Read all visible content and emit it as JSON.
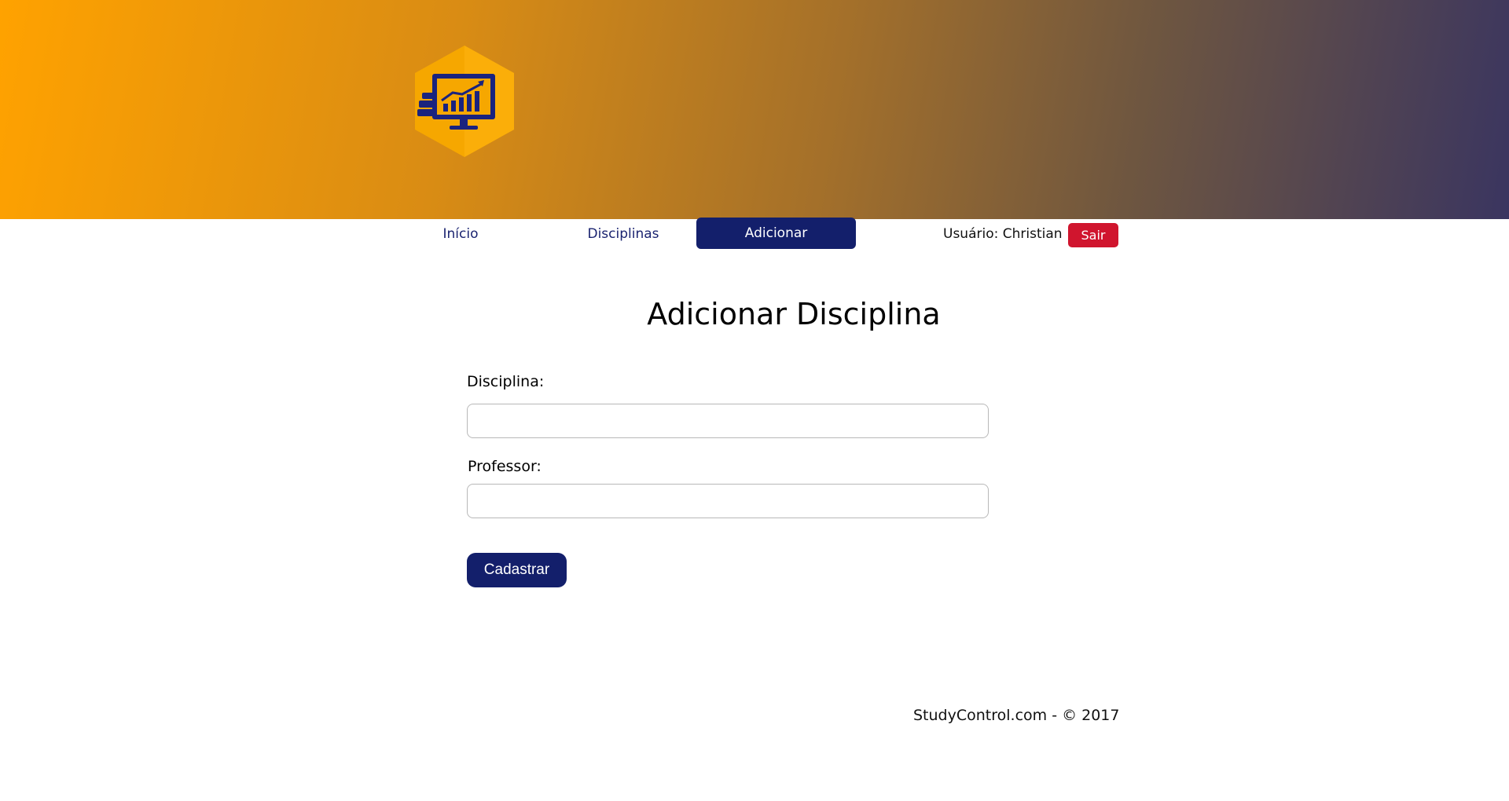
{
  "header": {
    "logo_icon": "chart-monitor-books-icon",
    "gradient_colors": [
      "#ffa200",
      "#3a3560"
    ]
  },
  "nav": {
    "items": [
      {
        "label": "Início"
      },
      {
        "label": "Disciplinas"
      },
      {
        "label": "Adicionar"
      }
    ],
    "active_index": 2,
    "user_label": "Usuário: Christian",
    "logout_label": "Sair",
    "accent_color": "#131f6b",
    "logout_color": "#d0152e"
  },
  "main": {
    "title": "Adicionar Disciplina",
    "form": {
      "subject_label": "Disciplina:",
      "subject_value": "",
      "professor_label": "Professor:",
      "professor_value": "",
      "submit_label": "Cadastrar"
    }
  },
  "footer": {
    "text": "StudyControl.com - © 2017"
  }
}
